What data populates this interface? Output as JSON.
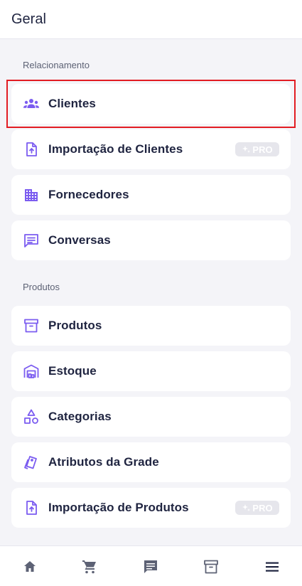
{
  "header": {
    "title": "Geral"
  },
  "sections": {
    "relacionamento": {
      "label": "Relacionamento",
      "items": [
        {
          "label": "Clientes",
          "icon": "users-icon"
        },
        {
          "label": "Importação de Clientes",
          "icon": "file-upload-icon",
          "badge": "PRO"
        },
        {
          "label": "Fornecedores",
          "icon": "building-icon"
        },
        {
          "label": "Conversas",
          "icon": "chat-icon"
        }
      ]
    },
    "produtos": {
      "label": "Produtos",
      "items": [
        {
          "label": "Produtos",
          "icon": "archive-box-icon"
        },
        {
          "label": "Estoque",
          "icon": "warehouse-icon"
        },
        {
          "label": "Categorias",
          "icon": "shapes-icon"
        },
        {
          "label": "Atributos da Grade",
          "icon": "swatches-icon"
        },
        {
          "label": "Importação de Produtos",
          "icon": "file-upload-icon",
          "badge": "PRO"
        }
      ]
    }
  },
  "bottom_nav": [
    {
      "icon": "home-icon",
      "active": false
    },
    {
      "icon": "cart-icon",
      "active": false
    },
    {
      "icon": "chat-icon",
      "active": false
    },
    {
      "icon": "archive-box-icon",
      "active": false
    },
    {
      "icon": "menu-icon",
      "active": true
    }
  ],
  "colors": {
    "accent": "#7b5cf0",
    "text": "#1f2440",
    "background": "#f4f4f8",
    "highlight": "#e21c23",
    "nav_icon": "#5d6275",
    "nav_active": "#1f2440"
  }
}
